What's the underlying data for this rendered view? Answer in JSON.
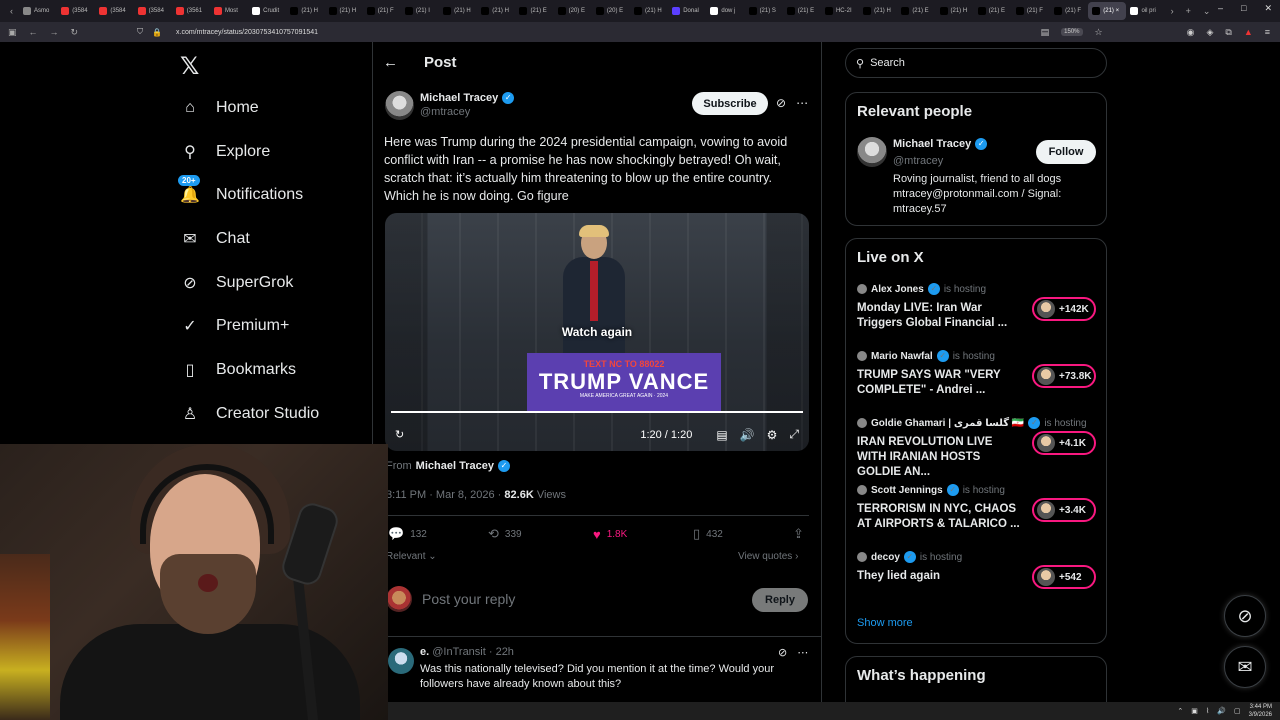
{
  "browser": {
    "tabs": [
      {
        "label": "Asmo",
        "color": "#888"
      },
      {
        "label": "(3584",
        "color": "#e33"
      },
      {
        "label": "(3584",
        "color": "#e33"
      },
      {
        "label": "(3584",
        "color": "#e33"
      },
      {
        "label": "(3561",
        "color": "#e33"
      },
      {
        "label": "Most",
        "color": "#e33"
      },
      {
        "label": "Crudit",
        "color": "#fff"
      },
      {
        "label": "(21) H",
        "color": "#000"
      },
      {
        "label": "(21) H",
        "color": "#000"
      },
      {
        "label": "(21) F",
        "color": "#000"
      },
      {
        "label": "(21) I",
        "color": "#000"
      },
      {
        "label": "(21) H",
        "color": "#000"
      },
      {
        "label": "(21) H",
        "color": "#000"
      },
      {
        "label": "(21) E",
        "color": "#000"
      },
      {
        "label": "(20) E",
        "color": "#000"
      },
      {
        "label": "(20) E",
        "color": "#000"
      },
      {
        "label": "(21) H",
        "color": "#000"
      },
      {
        "label": "Donal",
        "color": "#5b3fff"
      },
      {
        "label": "dow j",
        "color": "#fff"
      },
      {
        "label": "(21) S",
        "color": "#000"
      },
      {
        "label": "(21) E",
        "color": "#000"
      },
      {
        "label": "HC-2I",
        "color": "#000"
      },
      {
        "label": "(21) H",
        "color": "#000"
      },
      {
        "label": "(21) E",
        "color": "#000"
      },
      {
        "label": "(21) H",
        "color": "#000"
      },
      {
        "label": "(21) E",
        "color": "#000"
      },
      {
        "label": "(21) F",
        "color": "#000"
      },
      {
        "label": "(21) F",
        "color": "#000"
      },
      {
        "label": "(21) ×",
        "color": "#000"
      },
      {
        "label": "oil pri",
        "color": "#fff"
      }
    ],
    "url": "x.com/mtracey/status/2030753410757091541",
    "zoom": "150%"
  },
  "nav": {
    "logo": "𝕏",
    "items": [
      {
        "label": "Home",
        "icon": "home-icon",
        "glyph": "⌂"
      },
      {
        "label": "Explore",
        "icon": "search-icon",
        "glyph": "⚲"
      },
      {
        "label": "Notifications",
        "icon": "bell-icon",
        "glyph": "🔔",
        "badge": "20+"
      },
      {
        "label": "Chat",
        "icon": "mail-icon",
        "glyph": "✉"
      },
      {
        "label": "SuperGrok",
        "icon": "grok-icon",
        "glyph": "⊘"
      },
      {
        "label": "Premium+",
        "icon": "verified-icon",
        "glyph": "✓"
      },
      {
        "label": "Bookmarks",
        "icon": "bookmark-icon",
        "glyph": "▯"
      },
      {
        "label": "Creator Studio",
        "icon": "creator-icon",
        "glyph": "♙"
      }
    ]
  },
  "post": {
    "header_title": "Post",
    "author_name": "Michael Tracey",
    "author_handle": "@mtracey",
    "subscribe_label": "Subscribe",
    "text": "Here was Trump during the 2024 presidential campaign, vowing to avoid conflict with Iran -- a promise he has now shockingly betrayed! Oh wait, scratch that: it’s actually him threatening to blow up the entire country. Which he is now doing. Go figure",
    "video": {
      "watch_again": "Watch again",
      "time": "1:20 / 1:20",
      "podium_line1": "TEXT NC TO 88022",
      "podium_line2": "TRUMP VANCE",
      "podium_line3": "MAKE AMERICA GREAT AGAIN · 2024",
      "progress": 1.0
    },
    "from_label": "From",
    "from_name": "Michael Tracey",
    "timestamp": "3:11 PM · Mar 8, 2026 ·",
    "views_count": "82.6K",
    "views_label": "Views",
    "stats": {
      "replies": "132",
      "reposts": "339",
      "likes": "1.8K",
      "bookmarks": "432"
    },
    "sort_label": "Relevant ⌄",
    "view_quotes": "View quotes ›",
    "reply_placeholder": "Post your reply",
    "reply_button": "Reply"
  },
  "reply": {
    "name": "e.",
    "handle": "@InTransit · 22h",
    "text": "Was this nationally televised? Did you mention it at the time? Would your followers have already known about this?"
  },
  "sidebar": {
    "search_placeholder": "Search",
    "relevant_title": "Relevant people",
    "relevant_person": {
      "name": "Michael Tracey",
      "handle": "@mtracey",
      "bio": "Roving journalist, friend to all dogs mtracey@protonmail.com / Signal: mtracey.57",
      "follow_label": "Follow"
    },
    "live_title": "Live on X",
    "live": [
      {
        "host": "Alex Jones",
        "status": "is hosting",
        "title": "Monday LIVE: Iran War Triggers Global Financial ...",
        "count": "+142K"
      },
      {
        "host": "Mario Nawfal",
        "status": "is hosting",
        "title": "TRUMP SAYS WAR \"VERY COMPLETE\" - Andrei ...",
        "count": "+73.8K"
      },
      {
        "host": "Goldie Ghamari | گلسا قمری 🇮🇷",
        "status": "is hosting",
        "title": "IRAN REVOLUTION LIVE WITH IRANIAN HOSTS GOLDIE AN...",
        "count": "+4.1K"
      },
      {
        "host": "Scott Jennings",
        "status": "is hosting",
        "title": "TERRORISM IN NYC, CHAOS AT AIRPORTS & TALARICO ...",
        "count": "+3.4K"
      },
      {
        "host": "decoy",
        "status": "is hosting",
        "title": "They lied again",
        "count": "+542"
      }
    ],
    "show_more": "Show more",
    "happening_title": "What’s happening"
  },
  "taskbar": {
    "time": "3:44 PM",
    "date": "3/9/2026"
  }
}
